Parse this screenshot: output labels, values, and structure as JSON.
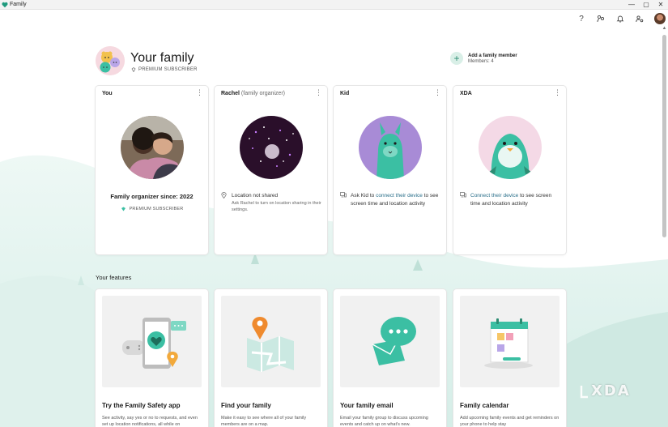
{
  "window": {
    "title": "Family",
    "controls": {
      "minimize": "—",
      "maximize": "▢",
      "close": "✕"
    }
  },
  "toolbar": {
    "help_icon": "question-icon",
    "help_glyph": "?",
    "connect_icon": "people-connect-icon",
    "notification_icon": "bell-icon",
    "settings_icon": "family-settings-icon"
  },
  "header": {
    "title": "Your family",
    "premium_label": "PREMIUM SUBSCRIBER",
    "add_member_label": "Add a family member",
    "members_label": "Members: 4",
    "add_glyph": "+"
  },
  "members": [
    {
      "name": "You",
      "role": "",
      "line1": "Family organizer since: 2022",
      "badge": "PREMIUM SUBSCRIBER"
    },
    {
      "name": "Rachel",
      "role": "(family organizer)",
      "status": "Location not shared",
      "status_sub": "Ask Rachel to turn on location sharing in their settings."
    },
    {
      "name": "Kid",
      "pre": "Ask Kid to ",
      "link": "connect their device",
      "post": " to see screen time and location activity"
    },
    {
      "name": "XDA",
      "pre": "",
      "link": "Connect their device",
      "post": " to see screen time and location activity"
    }
  ],
  "menu_glyph": "⋮",
  "features": {
    "section_title": "Your features",
    "items": [
      {
        "title": "Try the Family Safety app",
        "desc": "See activity, say yes or no to requests, and even set up location notifications, all while on"
      },
      {
        "title": "Find your family",
        "desc": "Make it easy to see where all of your family members are on a map."
      },
      {
        "title": "Your family email",
        "desc": "Email your family group to discuss upcoming events and catch up on what's new."
      },
      {
        "title": "Family calendar",
        "desc": "Add upcoming family events and get reminders on your phone to help stay"
      }
    ]
  },
  "watermark": "XDA",
  "colors": {
    "accent": "#2c8c73",
    "link": "#2a6f8a",
    "mint_background": "#e2f3ef"
  }
}
